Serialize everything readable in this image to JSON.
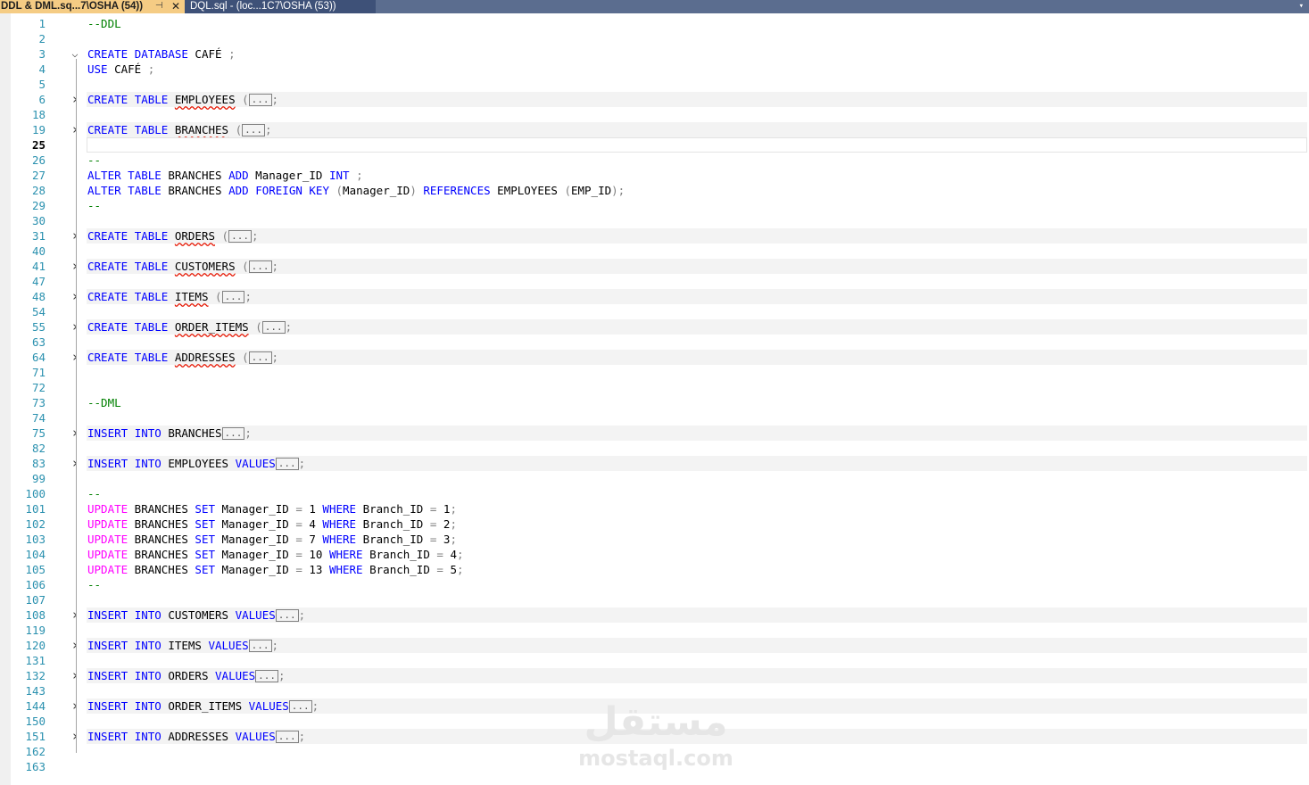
{
  "tabs": {
    "active": {
      "label": "DDL & DML.sq...7\\OSHA (54))",
      "pin": "⊣",
      "close": "✕"
    },
    "inactive": {
      "label": "DQL.sql - (loc...1C7\\OSHA (53))"
    },
    "dropdown": "▾"
  },
  "editor": {
    "current_line": "25",
    "lines": [
      {
        "n": "1",
        "kind": "comment",
        "text": "--DDL"
      },
      {
        "n": "2"
      },
      {
        "n": "3",
        "kind": "createdb",
        "fold": "open"
      },
      {
        "n": "4",
        "kind": "use"
      },
      {
        "n": "5"
      },
      {
        "n": "6",
        "kind": "table",
        "name": "EMPLOYEES",
        "fold": "closed"
      },
      {
        "n": "18"
      },
      {
        "n": "19",
        "kind": "table",
        "name": "BRANCHES",
        "fold": "closed"
      },
      {
        "n": "25",
        "kind": "current"
      },
      {
        "n": "26",
        "kind": "comment",
        "text": "--"
      },
      {
        "n": "27",
        "kind": "alter1"
      },
      {
        "n": "28",
        "kind": "alter2"
      },
      {
        "n": "29",
        "kind": "comment",
        "text": "--"
      },
      {
        "n": "30"
      },
      {
        "n": "31",
        "kind": "table",
        "name": "ORDERS",
        "fold": "closed"
      },
      {
        "n": "40"
      },
      {
        "n": "41",
        "kind": "table",
        "name": "CUSTOMERS",
        "fold": "closed"
      },
      {
        "n": "47"
      },
      {
        "n": "48",
        "kind": "table",
        "name": "ITEMS",
        "fold": "closed"
      },
      {
        "n": "54"
      },
      {
        "n": "55",
        "kind": "table",
        "name": "ORDER_ITEMS",
        "fold": "closed"
      },
      {
        "n": "63"
      },
      {
        "n": "64",
        "kind": "table",
        "name": "ADDRESSES",
        "fold": "closed"
      },
      {
        "n": "71"
      },
      {
        "n": "72"
      },
      {
        "n": "73",
        "kind": "comment",
        "text": "--DML"
      },
      {
        "n": "74"
      },
      {
        "n": "75",
        "kind": "insert",
        "name": "BRANCHES",
        "values": false,
        "fold": "closed"
      },
      {
        "n": "82"
      },
      {
        "n": "83",
        "kind": "insert",
        "name": "EMPLOYEES",
        "values": true,
        "fold": "closed"
      },
      {
        "n": "99"
      },
      {
        "n": "100",
        "kind": "comment",
        "text": "--"
      },
      {
        "n": "101",
        "kind": "update",
        "mgr": "1",
        "branch": "1"
      },
      {
        "n": "102",
        "kind": "update",
        "mgr": "4",
        "branch": "2"
      },
      {
        "n": "103",
        "kind": "update",
        "mgr": "7",
        "branch": "3"
      },
      {
        "n": "104",
        "kind": "update",
        "mgr": "10",
        "branch": "4"
      },
      {
        "n": "105",
        "kind": "update",
        "mgr": "13",
        "branch": "5"
      },
      {
        "n": "106",
        "kind": "comment",
        "text": "--"
      },
      {
        "n": "107"
      },
      {
        "n": "108",
        "kind": "insert",
        "name": "CUSTOMERS",
        "values": true,
        "fold": "closed"
      },
      {
        "n": "119"
      },
      {
        "n": "120",
        "kind": "insert",
        "name": "ITEMS",
        "values": true,
        "fold": "closed"
      },
      {
        "n": "131"
      },
      {
        "n": "132",
        "kind": "insert",
        "name": "ORDERS",
        "values": true,
        "fold": "closed"
      },
      {
        "n": "143"
      },
      {
        "n": "144",
        "kind": "insert",
        "name": "ORDER_ITEMS",
        "values": true,
        "fold": "closed"
      },
      {
        "n": "150"
      },
      {
        "n": "151",
        "kind": "insert",
        "name": "ADDRESSES",
        "values": true,
        "fold": "closed"
      },
      {
        "n": "162"
      },
      {
        "n": "163"
      }
    ],
    "keywords": {
      "create": "CREATE",
      "database": "DATABASE",
      "table": "TABLE",
      "use": "USE",
      "alter": "ALTER",
      "add": "ADD",
      "int": "INT",
      "foreign": "FOREIGN",
      "key": "KEY",
      "references": "REFERENCES",
      "insert": "INSERT",
      "into": "INTO",
      "values": "VALUES",
      "update": "UPDATE",
      "set": "SET",
      "where": "WHERE"
    },
    "identifiers": {
      "db": "CAFÉ",
      "branches": "BRANCHES",
      "manager_id": "Manager_ID",
      "employees": "EMPLOYEES",
      "emp_id": "EMP_ID",
      "branch_id": "Branch_ID"
    },
    "ellipsis": "...",
    "semicolon": ";",
    "colors": {
      "keyword": "#0000ff",
      "dml": "#ff00ff",
      "comment": "#008000",
      "line_number": "#2b91af",
      "tab_active": "#f5cc84",
      "tab_bar": "#5b6d8f"
    }
  },
  "watermark": {
    "arabic": "مستقل",
    "latin": "mostaql.com"
  }
}
